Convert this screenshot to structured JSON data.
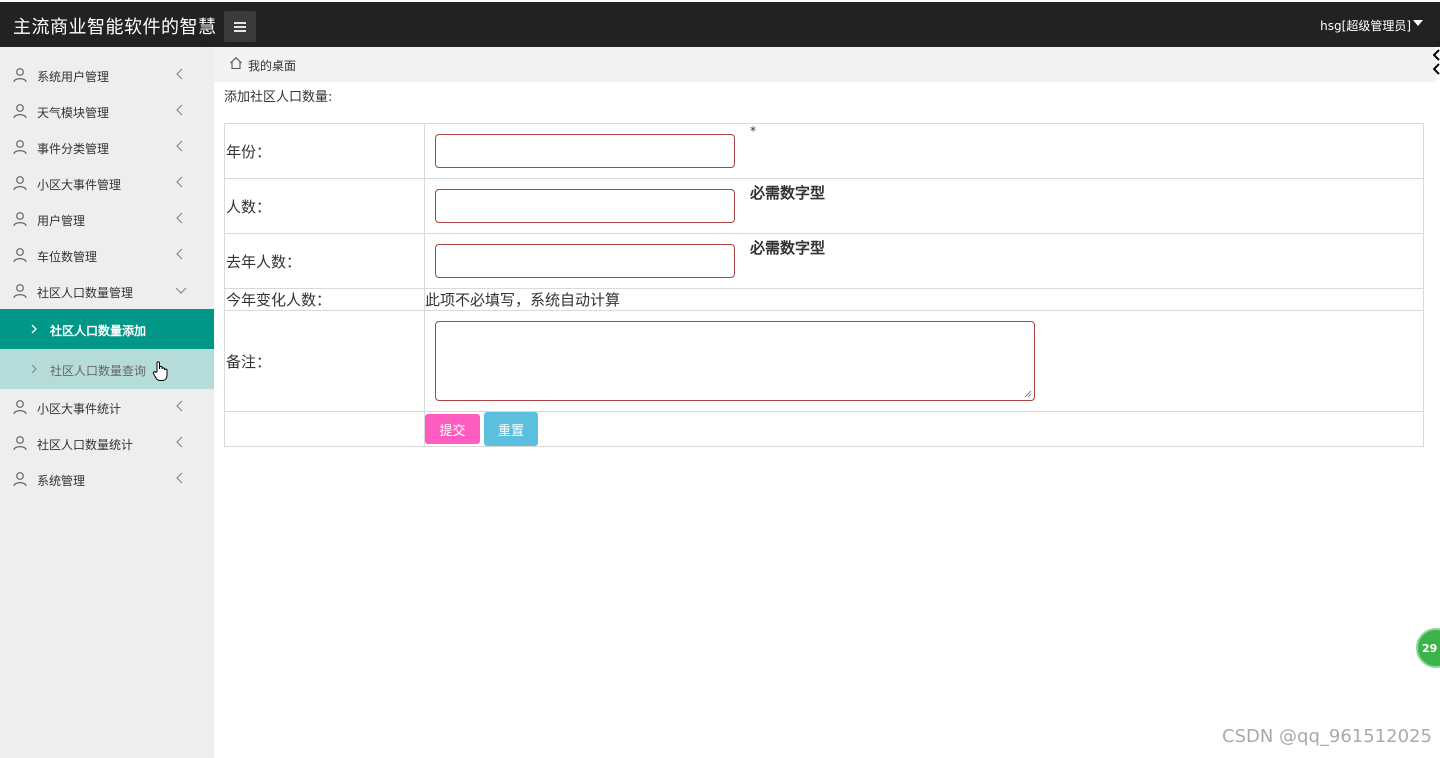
{
  "header": {
    "app_title": "主流商业智能软件的智慧",
    "user_label": "hsg[超级管理员]"
  },
  "sidebar": {
    "items": [
      {
        "label": "系统用户管理"
      },
      {
        "label": "天气模块管理"
      },
      {
        "label": "事件分类管理"
      },
      {
        "label": "小区大事件管理"
      },
      {
        "label": "用户管理"
      },
      {
        "label": "车位数管理"
      },
      {
        "label": "社区人口数量管理",
        "expanded": true,
        "children": [
          {
            "label": "社区人口数量添加",
            "state": "active"
          },
          {
            "label": "社区人口数量查询",
            "state": "hover"
          }
        ]
      },
      {
        "label": "小区大事件统计"
      },
      {
        "label": "社区人口数量统计"
      },
      {
        "label": "系统管理"
      }
    ]
  },
  "breadcrumb": {
    "home_label": "我的桌面"
  },
  "form": {
    "heading": "添加社区人口数量:",
    "year_label": "年份：",
    "year_hint": "*",
    "count_label": "人数：",
    "count_hint": "必需数字型",
    "last_year_label": "去年人数：",
    "last_year_hint": "必需数字型",
    "change_label": "今年变化人数：",
    "change_note": "此项不必填写，系统自动计算",
    "remark_label": "备注：",
    "submit_label": "提交",
    "reset_label": "重置"
  },
  "badge": {
    "text": "29"
  },
  "watermark": "CSDN @qq_961512025",
  "colors": {
    "topbar": "#222222",
    "sidebar": "#eeeeee",
    "active_item": "#009688",
    "hover_item": "#b6dcd9",
    "submit_button": "#ff5cc2",
    "reset_button": "#5bc0de",
    "input_border": "#a94442"
  }
}
